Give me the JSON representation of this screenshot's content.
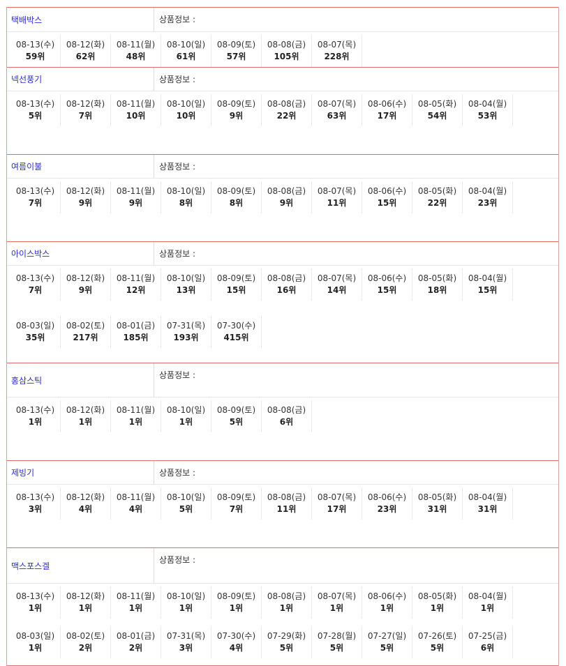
{
  "products": [
    {
      "name": "택배박스",
      "info_label": "상품정보 :",
      "ranks": [
        {
          "date": "08-13(수)",
          "rank": "59위"
        },
        {
          "date": "08-12(화)",
          "rank": "62위"
        },
        {
          "date": "08-11(월)",
          "rank": "48위"
        },
        {
          "date": "08-10(일)",
          "rank": "61위"
        },
        {
          "date": "08-09(토)",
          "rank": "57위"
        },
        {
          "date": "08-08(금)",
          "rank": "105위"
        },
        {
          "date": "08-07(목)",
          "rank": "228위"
        }
      ]
    },
    {
      "name": "넥선풍기",
      "info_label": "상품정보 :",
      "ranks": [
        {
          "date": "08-13(수)",
          "rank": "5위"
        },
        {
          "date": "08-12(화)",
          "rank": "7위"
        },
        {
          "date": "08-11(월)",
          "rank": "10위"
        },
        {
          "date": "08-10(일)",
          "rank": "10위"
        },
        {
          "date": "08-09(토)",
          "rank": "9위"
        },
        {
          "date": "08-08(금)",
          "rank": "22위"
        },
        {
          "date": "08-07(목)",
          "rank": "63위"
        },
        {
          "date": "08-06(수)",
          "rank": "17위"
        },
        {
          "date": "08-05(화)",
          "rank": "54위"
        },
        {
          "date": "08-04(월)",
          "rank": "53위"
        }
      ]
    },
    {
      "name": "여름이불",
      "info_label": "상품정보 :",
      "ranks": [
        {
          "date": "08-13(수)",
          "rank": "7위"
        },
        {
          "date": "08-12(화)",
          "rank": "9위"
        },
        {
          "date": "08-11(월)",
          "rank": "9위"
        },
        {
          "date": "08-10(일)",
          "rank": "8위"
        },
        {
          "date": "08-09(토)",
          "rank": "8위"
        },
        {
          "date": "08-08(금)",
          "rank": "9위"
        },
        {
          "date": "08-07(목)",
          "rank": "11위"
        },
        {
          "date": "08-06(수)",
          "rank": "15위"
        },
        {
          "date": "08-05(화)",
          "rank": "22위"
        },
        {
          "date": "08-04(월)",
          "rank": "23위"
        }
      ]
    },
    {
      "name": "아이스박스",
      "info_label": "상품정보 :",
      "ranks": [
        {
          "date": "08-13(수)",
          "rank": "7위"
        },
        {
          "date": "08-12(화)",
          "rank": "9위"
        },
        {
          "date": "08-11(월)",
          "rank": "12위"
        },
        {
          "date": "08-10(일)",
          "rank": "13위"
        },
        {
          "date": "08-09(토)",
          "rank": "15위"
        },
        {
          "date": "08-08(금)",
          "rank": "16위"
        },
        {
          "date": "08-07(목)",
          "rank": "14위"
        },
        {
          "date": "08-06(수)",
          "rank": "15위"
        },
        {
          "date": "08-05(화)",
          "rank": "18위"
        },
        {
          "date": "08-04(월)",
          "rank": "15위"
        },
        {
          "date": "08-03(일)",
          "rank": "35위"
        },
        {
          "date": "08-02(토)",
          "rank": "217위"
        },
        {
          "date": "08-01(금)",
          "rank": "185위"
        },
        {
          "date": "07-31(목)",
          "rank": "193위"
        },
        {
          "date": "07-30(수)",
          "rank": "415위"
        }
      ]
    },
    {
      "name": "홍삼스틱",
      "info_label": "상품정보 :",
      "ranks": [
        {
          "date": "08-13(수)",
          "rank": "1위"
        },
        {
          "date": "08-12(화)",
          "rank": "1위"
        },
        {
          "date": "08-11(월)",
          "rank": "1위"
        },
        {
          "date": "08-10(일)",
          "rank": "1위"
        },
        {
          "date": "08-09(토)",
          "rank": "5위"
        },
        {
          "date": "08-08(금)",
          "rank": "6위"
        }
      ]
    },
    {
      "name": "제빙기",
      "info_label": "상품정보 :",
      "ranks": [
        {
          "date": "08-13(수)",
          "rank": "3위"
        },
        {
          "date": "08-12(화)",
          "rank": "4위"
        },
        {
          "date": "08-11(월)",
          "rank": "4위"
        },
        {
          "date": "08-10(일)",
          "rank": "5위"
        },
        {
          "date": "08-09(토)",
          "rank": "7위"
        },
        {
          "date": "08-08(금)",
          "rank": "11위"
        },
        {
          "date": "08-07(목)",
          "rank": "17위"
        },
        {
          "date": "08-06(수)",
          "rank": "23위"
        },
        {
          "date": "08-05(화)",
          "rank": "31위"
        },
        {
          "date": "08-04(월)",
          "rank": "31위"
        }
      ]
    },
    {
      "name": "맥스포스겔",
      "info_label": "상품정보 :",
      "ranks": [
        {
          "date": "08-13(수)",
          "rank": "1위"
        },
        {
          "date": "08-12(화)",
          "rank": "1위"
        },
        {
          "date": "08-11(월)",
          "rank": "1위"
        },
        {
          "date": "08-10(일)",
          "rank": "1위"
        },
        {
          "date": "08-09(토)",
          "rank": "1위"
        },
        {
          "date": "08-08(금)",
          "rank": "1위"
        },
        {
          "date": "08-07(목)",
          "rank": "1위"
        },
        {
          "date": "08-06(수)",
          "rank": "1위"
        },
        {
          "date": "08-05(화)",
          "rank": "1위"
        },
        {
          "date": "08-04(월)",
          "rank": "1위"
        },
        {
          "date": "08-03(일)",
          "rank": "1위"
        },
        {
          "date": "08-02(토)",
          "rank": "2위"
        },
        {
          "date": "08-01(금)",
          "rank": "2위"
        },
        {
          "date": "07-31(목)",
          "rank": "3위"
        },
        {
          "date": "07-30(수)",
          "rank": "4위"
        },
        {
          "date": "07-29(화)",
          "rank": "5위"
        },
        {
          "date": "07-28(월)",
          "rank": "5위"
        },
        {
          "date": "07-27(일)",
          "rank": "5위"
        },
        {
          "date": "07-26(토)",
          "rank": "5위"
        },
        {
          "date": "07-25(금)",
          "rank": "6위"
        }
      ]
    }
  ]
}
